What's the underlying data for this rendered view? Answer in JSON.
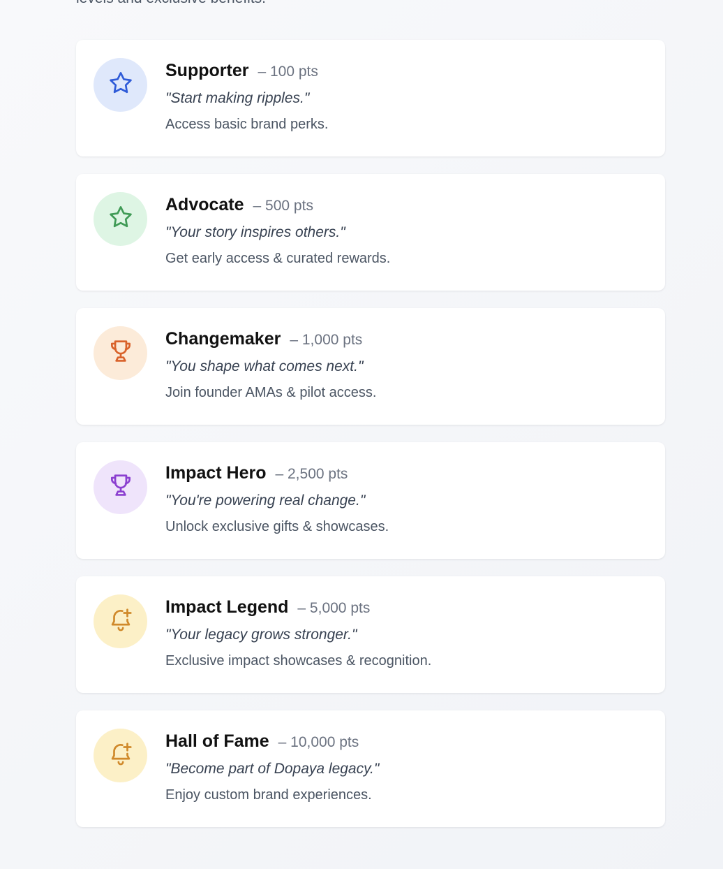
{
  "intro": {
    "text": "levels and exclusive benefits."
  },
  "tiers": [
    {
      "name": "Supporter",
      "points": "– 100 pts",
      "quote": "\"Start making ripples.\"",
      "benefit": "Access basic brand perks.",
      "icon": "star-icon",
      "icon_color": "#2f5bd8",
      "icon_bg": "#dfe8fb"
    },
    {
      "name": "Advocate",
      "points": "– 500 pts",
      "quote": "\"Your story inspires others.\"",
      "benefit": "Get early access & curated rewards.",
      "icon": "star-icon",
      "icon_color": "#3f9a55",
      "icon_bg": "#def5e4"
    },
    {
      "name": "Changemaker",
      "points": "– 1,000 pts",
      "quote": "\"You shape what comes next.\"",
      "benefit": "Join founder AMAs & pilot access.",
      "icon": "trophy-icon",
      "icon_color": "#d9622b",
      "icon_bg": "#fcebd9"
    },
    {
      "name": "Impact Hero",
      "points": "– 2,500 pts",
      "quote": "\"You're powering real change.\"",
      "benefit": "Unlock exclusive gifts & showcases.",
      "icon": "trophy-icon",
      "icon_color": "#8b3fd0",
      "icon_bg": "#efe4fb"
    },
    {
      "name": "Impact Legend",
      "points": "– 5,000 pts",
      "quote": "\"Your legacy grows stronger.\"",
      "benefit": "Exclusive impact showcases & recognition.",
      "icon": "bell-plus-icon",
      "icon_color": "#d0892a",
      "icon_bg": "#fcf0c7"
    },
    {
      "name": "Hall of Fame",
      "points": "– 10,000 pts",
      "quote": "\"Become part of Dopaya legacy.\"",
      "benefit": "Enjoy custom brand experiences.",
      "icon": "bell-plus-icon",
      "icon_color": "#d0892a",
      "icon_bg": "#fcf0c7"
    }
  ]
}
